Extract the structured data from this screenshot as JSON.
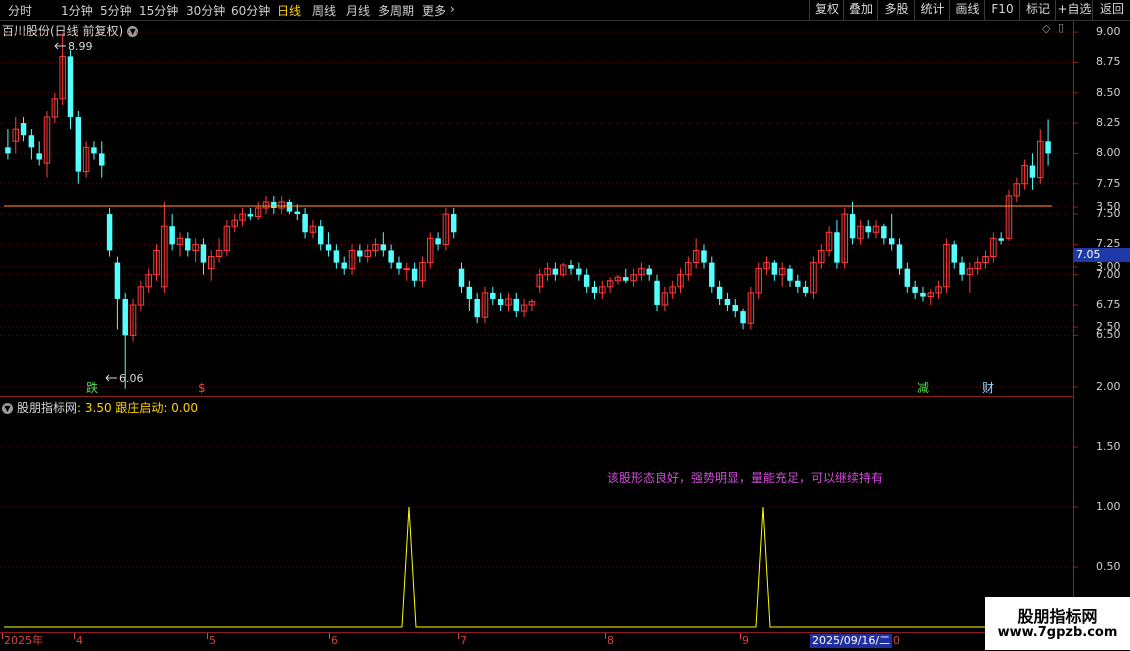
{
  "periods": [
    "分时",
    "1分钟",
    "5分钟",
    "15分钟",
    "30分钟",
    "60分钟",
    "日线",
    "周线",
    "月线",
    "多周期",
    "更多"
  ],
  "active_period": "日线",
  "tools": [
    "复权",
    "叠加",
    "多股",
    "统计",
    "画线",
    "F10",
    "标记",
    "+自选",
    "返回"
  ],
  "stock_header": "百川股份(日线 前复权)",
  "price_axis": [
    "9.00",
    "8.75",
    "8.50",
    "8.25",
    "8.00",
    "7.75",
    "7.50",
    "7.25",
    "7.00",
    "6.75",
    "6.50"
  ],
  "last_price": "7.05",
  "high_label": "8.99",
  "low_label": "6.06",
  "markers": {
    "die": "跌",
    "dollar": "$",
    "jian": "减",
    "cai": "财"
  },
  "indicator": {
    "name": "股朋指标网",
    "value": ": 3.50",
    "name2": "跟庄启动",
    "value2": ": 0.00"
  },
  "indicator_axis": [
    "3.50",
    "3.00",
    "2.50",
    "2.00",
    "1.50",
    "1.00",
    "0.50"
  ],
  "message": "该股形态良好，强势明显，量能充足，可以继续持有",
  "date_axis": [
    "2025年",
    "4",
    "5",
    "6",
    "7",
    "8",
    "9"
  ],
  "selected_date": "2025/09/16/二",
  "date_tail": "0",
  "watermark": {
    "line1": "股朋指标网",
    "line2": "www.7gpzb.com"
  },
  "colors": {
    "up": "#ff3b3b",
    "down": "#54ffff",
    "signal": "#ffff00",
    "msg": "#d24bd9"
  },
  "chart_data": {
    "type": "candlestick",
    "ylim": [
      6.0,
      9.1
    ],
    "candles": [
      [
        8.05,
        8.2,
        7.95,
        8.0
      ],
      [
        8.1,
        8.3,
        8.0,
        8.2
      ],
      [
        8.25,
        8.3,
        8.1,
        8.15
      ],
      [
        8.15,
        8.2,
        7.95,
        8.05
      ],
      [
        8.0,
        8.1,
        7.9,
        7.95
      ],
      [
        7.92,
        8.35,
        7.8,
        8.3
      ],
      [
        8.3,
        8.5,
        8.25,
        8.45
      ],
      [
        8.45,
        8.99,
        8.4,
        8.8
      ],
      [
        8.8,
        8.85,
        8.2,
        8.3
      ],
      [
        8.3,
        8.35,
        7.75,
        7.85
      ],
      [
        7.85,
        8.1,
        7.8,
        8.05
      ],
      [
        8.05,
        8.1,
        7.95,
        8.0
      ],
      [
        8.0,
        8.1,
        7.8,
        7.9
      ],
      [
        7.5,
        7.55,
        7.15,
        7.2
      ],
      [
        7.1,
        7.15,
        6.55,
        6.8
      ],
      [
        6.8,
        6.85,
        6.06,
        6.5
      ],
      [
        6.5,
        6.8,
        6.45,
        6.75
      ],
      [
        6.75,
        6.95,
        6.7,
        6.9
      ],
      [
        6.9,
        7.05,
        6.85,
        7.0
      ],
      [
        7.0,
        7.25,
        6.95,
        7.2
      ],
      [
        6.9,
        7.6,
        6.85,
        7.4
      ],
      [
        7.4,
        7.5,
        7.2,
        7.25
      ],
      [
        7.25,
        7.35,
        7.15,
        7.3
      ],
      [
        7.3,
        7.35,
        7.15,
        7.2
      ],
      [
        7.2,
        7.3,
        7.1,
        7.25
      ],
      [
        7.25,
        7.3,
        7.0,
        7.1
      ],
      [
        7.05,
        7.2,
        6.95,
        7.15
      ],
      [
        7.15,
        7.3,
        7.1,
        7.2
      ],
      [
        7.2,
        7.45,
        7.15,
        7.4
      ],
      [
        7.4,
        7.5,
        7.35,
        7.45
      ],
      [
        7.45,
        7.55,
        7.4,
        7.5
      ],
      [
        7.5,
        7.55,
        7.45,
        7.48
      ],
      [
        7.48,
        7.6,
        7.45,
        7.55
      ],
      [
        7.55,
        7.65,
        7.5,
        7.6
      ],
      [
        7.6,
        7.65,
        7.5,
        7.55
      ],
      [
        7.55,
        7.65,
        7.5,
        7.6
      ],
      [
        7.6,
        7.62,
        7.5,
        7.52
      ],
      [
        7.52,
        7.58,
        7.45,
        7.5
      ],
      [
        7.5,
        7.55,
        7.3,
        7.35
      ],
      [
        7.35,
        7.45,
        7.3,
        7.4
      ],
      [
        7.4,
        7.45,
        7.2,
        7.25
      ],
      [
        7.25,
        7.35,
        7.15,
        7.2
      ],
      [
        7.2,
        7.25,
        7.05,
        7.1
      ],
      [
        7.1,
        7.15,
        7.0,
        7.05
      ],
      [
        7.05,
        7.25,
        7.0,
        7.2
      ],
      [
        7.2,
        7.25,
        7.1,
        7.15
      ],
      [
        7.15,
        7.25,
        7.1,
        7.2
      ],
      [
        7.2,
        7.3,
        7.15,
        7.25
      ],
      [
        7.25,
        7.35,
        7.15,
        7.2
      ],
      [
        7.2,
        7.25,
        7.05,
        7.1
      ],
      [
        7.1,
        7.15,
        7.0,
        7.05
      ],
      [
        7.05,
        7.1,
        6.95,
        7.05
      ],
      [
        7.05,
        7.1,
        6.9,
        6.95
      ],
      [
        6.95,
        7.15,
        6.9,
        7.1
      ],
      [
        7.1,
        7.35,
        7.05,
        7.3
      ],
      [
        7.3,
        7.35,
        7.2,
        7.25
      ],
      [
        7.25,
        7.55,
        7.2,
        7.5
      ],
      [
        7.5,
        7.55,
        7.3,
        7.35
      ],
      [
        7.05,
        7.1,
        6.85,
        6.9
      ],
      [
        6.9,
        6.95,
        6.7,
        6.8
      ],
      [
        6.8,
        6.85,
        6.6,
        6.65
      ],
      [
        6.65,
        6.9,
        6.6,
        6.85
      ],
      [
        6.85,
        6.9,
        6.75,
        6.8
      ],
      [
        6.8,
        6.85,
        6.7,
        6.75
      ],
      [
        6.75,
        6.85,
        6.7,
        6.8
      ],
      [
        6.8,
        6.85,
        6.65,
        6.7
      ],
      [
        6.7,
        6.8,
        6.65,
        6.75
      ],
      [
        6.75,
        6.8,
        6.7,
        6.78
      ],
      [
        6.9,
        7.05,
        6.85,
        7.0
      ],
      [
        7.0,
        7.1,
        6.95,
        7.05
      ],
      [
        7.05,
        7.1,
        6.95,
        7.0
      ],
      [
        7.0,
        7.1,
        6.98,
        7.08
      ],
      [
        7.08,
        7.12,
        7.0,
        7.05
      ],
      [
        7.05,
        7.1,
        6.95,
        7.0
      ],
      [
        7.0,
        7.05,
        6.85,
        6.9
      ],
      [
        6.9,
        6.95,
        6.8,
        6.85
      ],
      [
        6.85,
        6.95,
        6.8,
        6.9
      ],
      [
        6.9,
        6.98,
        6.85,
        6.95
      ],
      [
        6.95,
        7.0,
        6.92,
        6.98
      ],
      [
        6.98,
        7.05,
        6.93,
        6.95
      ],
      [
        6.95,
        7.05,
        6.9,
        7.0
      ],
      [
        7.0,
        7.1,
        6.95,
        7.05
      ],
      [
        7.05,
        7.08,
        6.95,
        7.0
      ],
      [
        6.95,
        7.0,
        6.7,
        6.75
      ],
      [
        6.75,
        6.9,
        6.7,
        6.85
      ],
      [
        6.85,
        6.95,
        6.8,
        6.9
      ],
      [
        6.9,
        7.05,
        6.85,
        7.0
      ],
      [
        7.0,
        7.15,
        6.95,
        7.1
      ],
      [
        7.1,
        7.3,
        7.05,
        7.2
      ],
      [
        7.2,
        7.25,
        7.05,
        7.1
      ],
      [
        7.1,
        7.15,
        6.85,
        6.9
      ],
      [
        6.9,
        6.95,
        6.75,
        6.8
      ],
      [
        6.8,
        6.85,
        6.7,
        6.75
      ],
      [
        6.75,
        6.8,
        6.65,
        6.7
      ],
      [
        6.7,
        6.72,
        6.55,
        6.6
      ],
      [
        6.6,
        6.9,
        6.55,
        6.85
      ],
      [
        6.85,
        7.1,
        6.8,
        7.05
      ],
      [
        7.05,
        7.15,
        7.0,
        7.1
      ],
      [
        7.1,
        7.12,
        6.95,
        7.0
      ],
      [
        7.0,
        7.1,
        6.9,
        7.05
      ],
      [
        7.05,
        7.08,
        6.9,
        6.95
      ],
      [
        6.95,
        7.0,
        6.85,
        6.9
      ],
      [
        6.9,
        6.95,
        6.82,
        6.85
      ],
      [
        6.85,
        7.15,
        6.8,
        7.1
      ],
      [
        7.1,
        7.25,
        7.05,
        7.2
      ],
      [
        7.2,
        7.4,
        7.15,
        7.35
      ],
      [
        7.35,
        7.45,
        7.05,
        7.1
      ],
      [
        7.1,
        7.55,
        7.05,
        7.5
      ],
      [
        7.5,
        7.6,
        7.25,
        7.3
      ],
      [
        7.3,
        7.45,
        7.25,
        7.4
      ],
      [
        7.4,
        7.45,
        7.3,
        7.35
      ],
      [
        7.35,
        7.45,
        7.3,
        7.4
      ],
      [
        7.4,
        7.42,
        7.25,
        7.3
      ],
      [
        7.3,
        7.5,
        7.2,
        7.25
      ],
      [
        7.25,
        7.3,
        7.0,
        7.05
      ],
      [
        7.05,
        7.1,
        6.85,
        6.9
      ],
      [
        6.9,
        6.95,
        6.8,
        6.85
      ],
      [
        6.85,
        6.9,
        6.78,
        6.82
      ],
      [
        6.82,
        6.88,
        6.75,
        6.85
      ],
      [
        6.85,
        6.95,
        6.8,
        6.9
      ],
      [
        6.9,
        7.3,
        6.85,
        7.25
      ],
      [
        7.25,
        7.28,
        7.05,
        7.1
      ],
      [
        7.1,
        7.15,
        6.95,
        7.0
      ],
      [
        7.0,
        7.1,
        6.85,
        7.05
      ],
      [
        7.05,
        7.15,
        7.0,
        7.1
      ],
      [
        7.1,
        7.2,
        7.05,
        7.15
      ],
      [
        7.15,
        7.35,
        7.1,
        7.3
      ],
      [
        7.3,
        7.35,
        7.25,
        7.28
      ],
      [
        7.3,
        7.7,
        7.28,
        7.65
      ],
      [
        7.65,
        7.8,
        7.6,
        7.75
      ],
      [
        7.75,
        7.95,
        7.7,
        7.9
      ],
      [
        7.9,
        8.0,
        7.7,
        7.8
      ],
      [
        7.8,
        8.2,
        7.75,
        8.1
      ],
      [
        8.1,
        8.28,
        7.9,
        8.0
      ]
    ],
    "indicator_signals": [
      409,
      763
    ]
  }
}
